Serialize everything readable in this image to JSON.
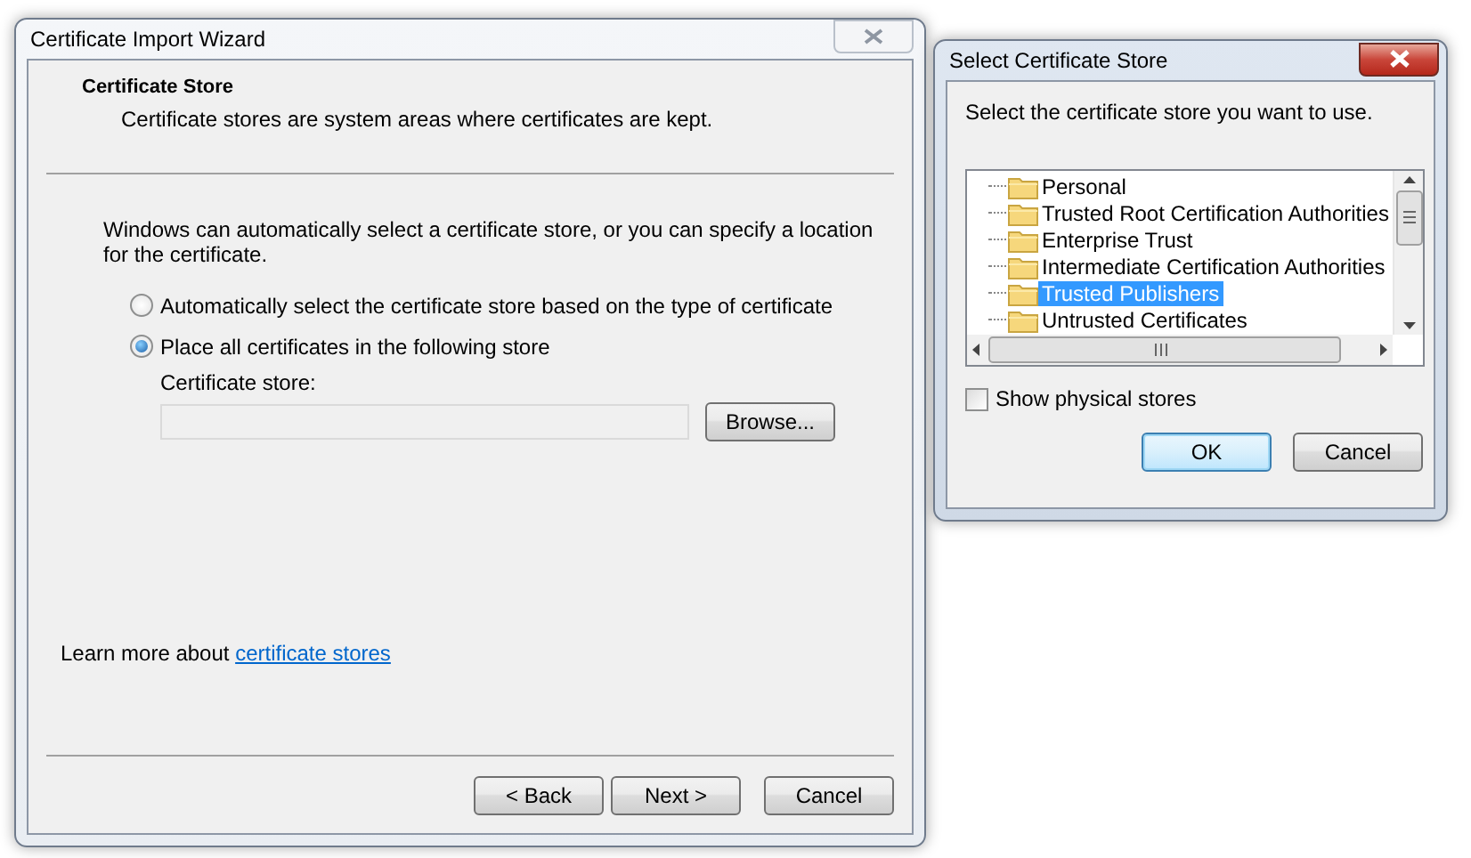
{
  "wizard": {
    "title": "Certificate Import Wizard",
    "heading": "Certificate Store",
    "subheading": "Certificate stores are system areas where certificates are kept.",
    "intro": "Windows can automatically select a certificate store, or you can specify a location for the certificate.",
    "options": [
      {
        "label": "Automatically select the certificate store based on the type of certificate",
        "selected": false
      },
      {
        "label": "Place all certificates in the following store",
        "selected": true
      }
    ],
    "store_label": "Certificate store:",
    "store_field": {
      "disabled": true
    },
    "browse_button": "Browse...",
    "learn_more": "Learn more about",
    "learn_more_link": "certificate stores",
    "buttons": [
      "< Back",
      "Next >",
      "Cancel"
    ]
  },
  "dialog": {
    "title": "Select Certificate Store",
    "prompt": "Select the certificate store you want to use.",
    "stores": [
      {
        "label": "Personal",
        "selected": false
      },
      {
        "label": "Trusted Root Certification Authorities",
        "selected": false
      },
      {
        "label": "Enterprise Trust",
        "selected": false
      },
      {
        "label": "Intermediate Certification Authorities",
        "selected": false
      },
      {
        "label": "Trusted Publishers",
        "selected": true
      },
      {
        "label": "Untrusted Certificates",
        "selected": false
      }
    ],
    "show_physical_stores": {
      "label": "Show physical stores",
      "checked": false
    },
    "buttons": [
      {
        "label": "OK",
        "default": true
      },
      {
        "label": "Cancel",
        "default": false
      }
    ]
  }
}
